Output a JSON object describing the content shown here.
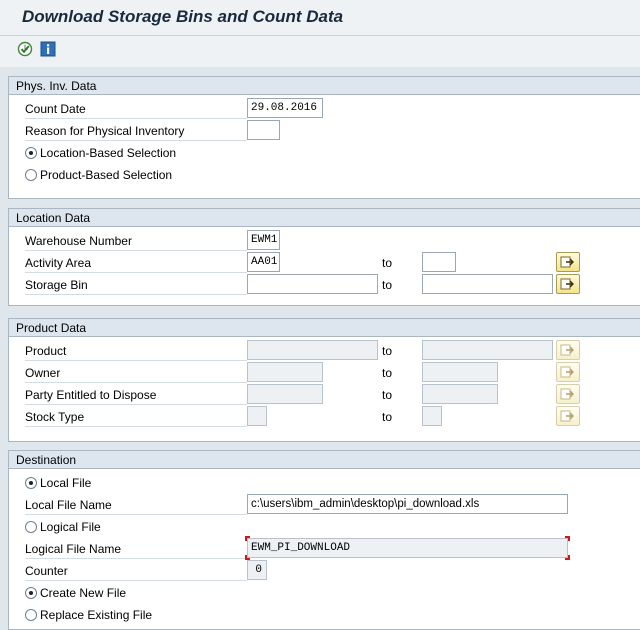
{
  "title": "Download Storage Bins and Count Data",
  "toolbar": {
    "execute_icon": "execute-clock-icon",
    "info_icon": "info-icon"
  },
  "sections": {
    "phys_inv": {
      "header": "Phys. Inv. Data",
      "count_date_label": "Count Date",
      "count_date_value": "29.08.2016",
      "reason_label": "Reason for Physical Inventory",
      "reason_value": "",
      "location_radio_label": "Location-Based Selection",
      "product_radio_label": "Product-Based Selection"
    },
    "location": {
      "header": "Location Data",
      "warehouse_label": "Warehouse Number",
      "warehouse_value": "EWM1",
      "activity_label": "Activity Area",
      "activity_from": "AA01",
      "activity_to": "",
      "bin_label": "Storage Bin",
      "bin_from": "",
      "bin_to": "",
      "to_label": "to"
    },
    "product": {
      "header": "Product Data",
      "product_label": "Product",
      "owner_label": "Owner",
      "party_label": "Party Entitled to Dispose",
      "stock_label": "Stock Type",
      "to_label": "to"
    },
    "destination": {
      "header": "Destination",
      "local_file_radio": "Local File",
      "local_file_name_label": "Local File Name",
      "local_file_name_value": "c:\\users\\ibm_admin\\desktop\\pi_download.xls",
      "logical_file_radio": "Logical File",
      "logical_file_name_label": "Logical File Name",
      "logical_file_name_value": "EWM_PI_DOWNLOAD",
      "counter_label": "Counter",
      "counter_value": "0",
      "create_new_radio": "Create New File",
      "replace_radio": "Replace Existing File"
    }
  },
  "colors": {
    "group_header_bg": "#dde6ee",
    "multiple_selection_btn": "#f4e48a",
    "required_marker": "#d01818"
  }
}
